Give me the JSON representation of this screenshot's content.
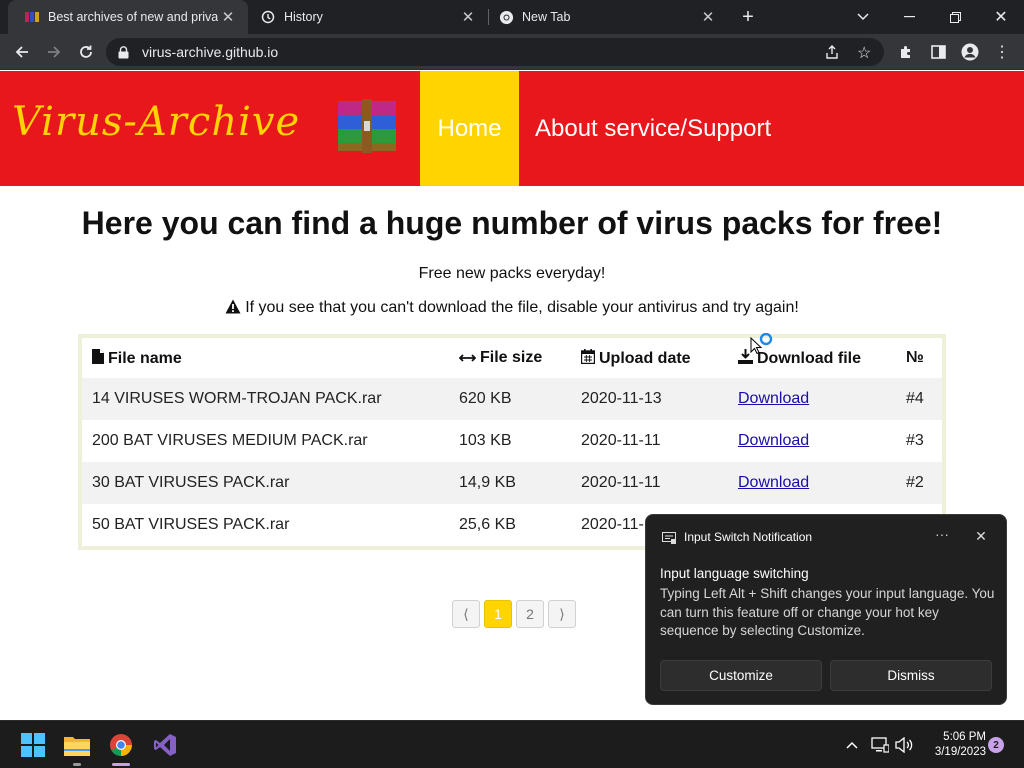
{
  "browser": {
    "tabs": [
      {
        "title": "Best archives of new and private",
        "active": true,
        "favicon": "archive-favicon"
      },
      {
        "title": "History",
        "active": false,
        "favicon": "history-icon"
      },
      {
        "title": "New Tab",
        "active": false,
        "favicon": "chrome-icon"
      }
    ],
    "url": "virus-archive.github.io"
  },
  "site": {
    "logo_text": "Virus-Archive",
    "nav": {
      "home": "Home",
      "about": "About service/Support"
    },
    "headline": "Here you can find a huge number of virus packs for free!",
    "subline": "Free new packs everyday!",
    "warning": "If you see that you can't download the file, disable your antivirus and try again!",
    "columns": [
      "File name",
      "File size",
      "Upload date",
      "Download file",
      "№"
    ],
    "rows": [
      {
        "name": "14 VIRUSES WORM-TROJAN PACK.rar",
        "size": "620 KB",
        "date": "2020-11-13",
        "link": "Download",
        "num": "#4"
      },
      {
        "name": "200 BAT VIRUSES MEDIUM PACK.rar",
        "size": "103 KB",
        "date": "2020-11-11",
        "link": "Download",
        "num": "#3"
      },
      {
        "name": "30 BAT VIRUSES PACK.rar",
        "size": "14,9 KB",
        "date": "2020-11-11",
        "link": "Download",
        "num": "#2"
      },
      {
        "name": "50 BAT VIRUSES PACK.rar",
        "size": "25,6 KB",
        "date": "2020-11-",
        "link": "",
        "num": ""
      }
    ],
    "pager": {
      "prev": "⟨",
      "pages": [
        "1",
        "2"
      ],
      "next": "⟩",
      "current": "1"
    }
  },
  "notification": {
    "app": "Input Switch Notification",
    "title": "Input language switching",
    "body": "Typing Left Alt + Shift changes your input language. You can turn this feature off or change your hot key sequence by selecting Customize.",
    "buttons": {
      "customize": "Customize",
      "dismiss": "Dismiss"
    }
  },
  "taskbar": {
    "time": "5:06 PM",
    "date": "3/19/2023",
    "badge": "2"
  },
  "colors": {
    "header_red": "#e7171b",
    "accent_yellow": "#ffd400",
    "link_blue": "#1a0dab"
  }
}
